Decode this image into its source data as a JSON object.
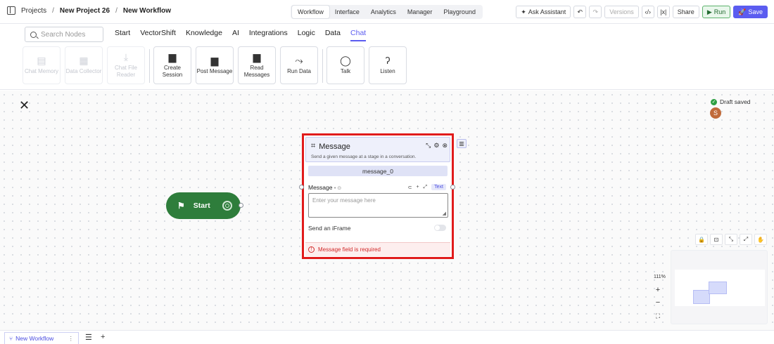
{
  "breadcrumb": {
    "root": "Projects",
    "project": "New Project 26",
    "workflow": "New Workflow",
    "sep": "/"
  },
  "top_tabs": [
    "Workflow",
    "Interface",
    "Analytics",
    "Manager",
    "Playground"
  ],
  "top_actions": {
    "ask_assistant": "Ask Assistant",
    "versions": "Versions",
    "share": "Share",
    "run": "Run",
    "save": "Save"
  },
  "search": {
    "placeholder": "Search Nodes"
  },
  "categories": [
    "Start",
    "VectorShift",
    "Knowledge",
    "AI",
    "Integrations",
    "Logic",
    "Data",
    "Chat"
  ],
  "active_category": "Chat",
  "tiles": [
    {
      "label": "Chat Memory",
      "icon": "chat-memory-icon"
    },
    {
      "label": "Data Collector",
      "icon": "data-collector-icon"
    },
    {
      "label": "Chat File Reader",
      "icon": "chat-file-reader-icon"
    },
    {
      "label": "Create Session",
      "icon": "create-session-icon"
    },
    {
      "label": "Post Message",
      "icon": "post-message-icon"
    },
    {
      "label": "Read Messages",
      "icon": "read-messages-icon"
    },
    {
      "label": "Run Data",
      "icon": "run-data-icon"
    },
    {
      "label": "Talk",
      "icon": "talk-icon"
    },
    {
      "label": "Listen",
      "icon": "listen-icon"
    }
  ],
  "canvas": {
    "draft_status": "Draft saved",
    "avatar_initial": "S",
    "start_node": {
      "label": "Start"
    },
    "message_node": {
      "title": "Message",
      "description": "Send a given message at a stage in a conversation.",
      "node_name": "message_0",
      "field_label": "Message",
      "field_type": "Text",
      "placeholder": "Enter your message here",
      "iframe_label": "Send an iFrame",
      "iframe_enabled": false,
      "error": "Message field is required"
    },
    "zoom": "111%",
    "zoom_in": "+",
    "zoom_out": "−"
  },
  "bottom": {
    "tab_label": "New Workflow"
  }
}
